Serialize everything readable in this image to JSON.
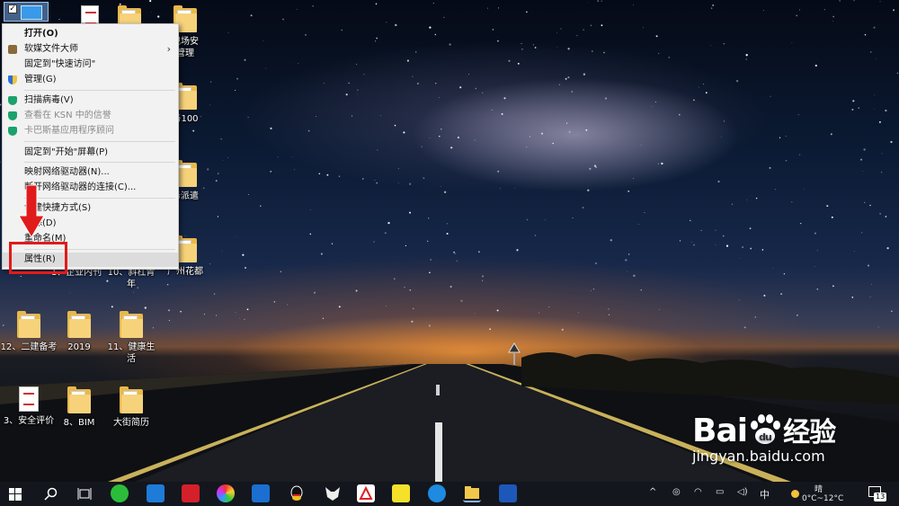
{
  "desktop": {
    "icons": [
      {
        "label": "现场安\n管理"
      },
      {
        "label": "与100"
      },
      {
        "label": "务派遣"
      },
      {
        "label": "1、企业内刊"
      },
      {
        "label": "10、斜杠青\n年"
      },
      {
        "label": "广州花都"
      },
      {
        "label": "12、二建备考"
      },
      {
        "label": "2019"
      },
      {
        "label": "11、健康生\n活"
      },
      {
        "label": "3、安全评价"
      },
      {
        "label": "8、BIM"
      },
      {
        "label": "大街简历"
      }
    ]
  },
  "context_menu": {
    "items": [
      {
        "label": "打开(O)"
      },
      {
        "label": "软媒文件大师"
      },
      {
        "label": "固定到\"快速访问\""
      },
      {
        "label": "管理(G)"
      },
      {
        "label": "扫描病毒(V)"
      },
      {
        "label": "查看在 KSN 中的信誉"
      },
      {
        "label": "卡巴斯基应用程序顾问"
      },
      {
        "label": "固定到\"开始\"屏幕(P)"
      },
      {
        "label": "映射网络驱动器(N)..."
      },
      {
        "label": "断开网络驱动器的连接(C)..."
      },
      {
        "label": "创建快捷方式(S)"
      },
      {
        "label": "删除(D)"
      },
      {
        "label": "重命名(M)"
      },
      {
        "label": "属性(R)"
      }
    ]
  },
  "watermark": {
    "brand": "Bai",
    "brand_suffix": "经验",
    "url": "jingyan.baidu.com"
  },
  "taskbar": {
    "ime": "中",
    "weather_label": "晴",
    "weather_temp": "0°C~12°C",
    "notification_count": "13"
  },
  "colors": {
    "highlight_box": "#e01b1b",
    "taskbar_bg": "#14161d",
    "menu_bg": "#f2f2f2"
  }
}
